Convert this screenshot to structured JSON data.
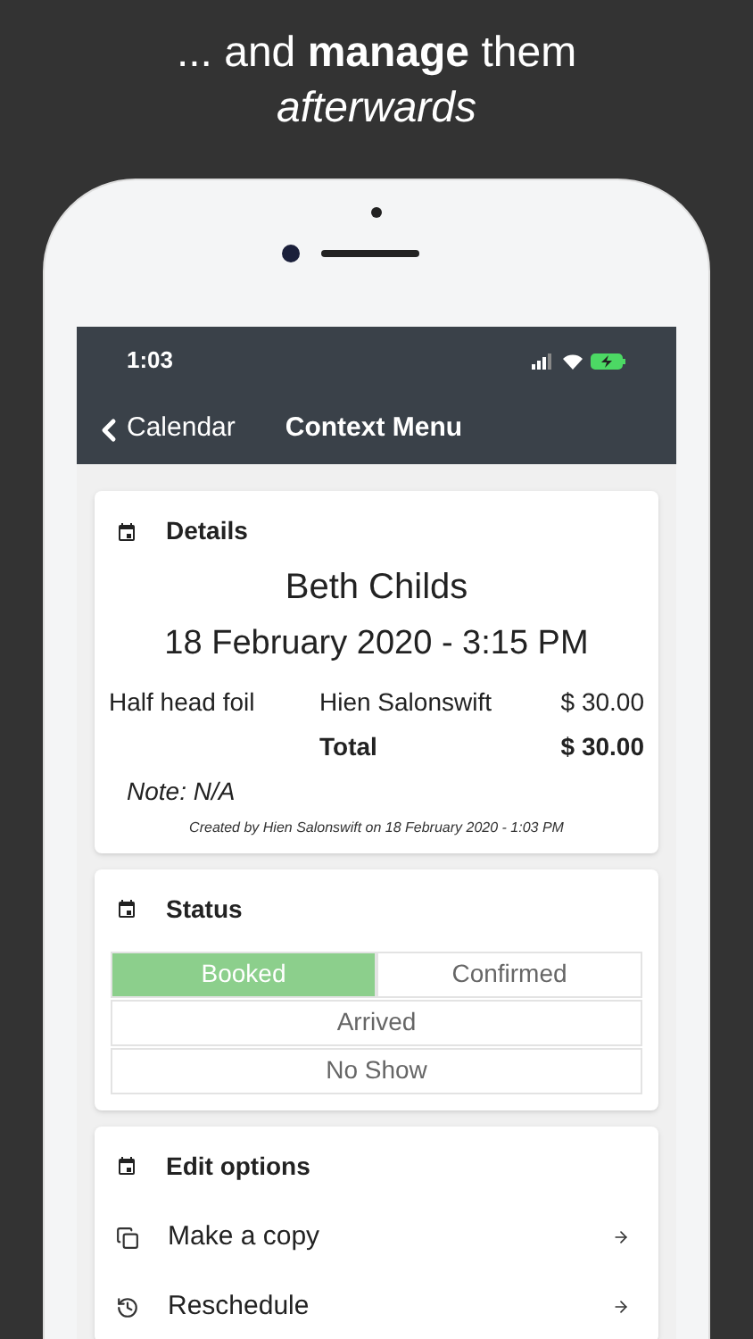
{
  "headline": {
    "line_1": "... and **manage** them",
    "line_2": "afterwards"
  },
  "status_bar": {
    "time": "1:03"
  },
  "nav": {
    "back": "Calendar",
    "title": "Context Menu"
  },
  "details": {
    "heading": "Details",
    "client": "Beth Childs",
    "datetime": "18 February 2020 - 3:15 PM",
    "service": {
      "name": "Half head foil",
      "staff": "Hien Salonswift",
      "price": "$ 30.00"
    },
    "total_label": "Total",
    "total": "$ 30.00",
    "note": "Note: N/A",
    "created": "Created by Hien Salonswift on 18 February 2020 - 1:03 PM"
  },
  "status": {
    "heading": "Status",
    "options": [
      {
        "label": "Booked",
        "selected": true
      },
      {
        "label": "Confirmed",
        "selected": false
      },
      {
        "label": "Arrived",
        "selected": false
      },
      {
        "label": "No Show",
        "selected": false
      }
    ]
  },
  "edit_options": {
    "heading": "Edit options",
    "items": [
      {
        "kind": "copy",
        "label": "Make a copy"
      },
      {
        "kind": "history",
        "label": "Reschedule"
      }
    ]
  }
}
